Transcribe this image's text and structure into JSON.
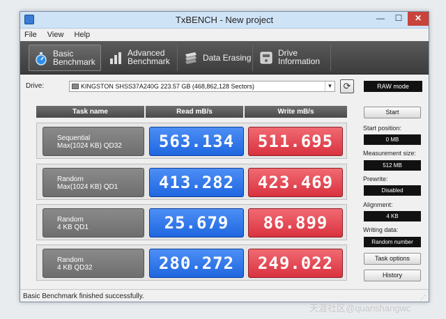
{
  "window": {
    "title": "TxBENCH - New project",
    "minimize_glyph": "—",
    "maximize_glyph": "☐",
    "close_glyph": "✕"
  },
  "menu": [
    "File",
    "View",
    "Help"
  ],
  "tabs": [
    {
      "label": "Basic\nBenchmark",
      "icon": "stopwatch-icon",
      "active": true
    },
    {
      "label": "Advanced\nBenchmark",
      "icon": "bar-chart-icon",
      "active": false
    },
    {
      "label": "Data Erasing",
      "icon": "eraser-icon",
      "active": false
    },
    {
      "label": "Drive\nInformation",
      "icon": "drive-info-icon",
      "active": false
    }
  ],
  "drive": {
    "label": "Drive:",
    "selected": "KINGSTON SHSS37A240G  223.57 GB (468,862,128 Sectors)",
    "raw_mode": "RAW mode"
  },
  "table": {
    "headers": [
      "Task name",
      "Read mB/s",
      "Write mB/s"
    ],
    "rows": [
      {
        "task": "Sequential\nMax(1024 KB) QD32",
        "read": "563.134",
        "write": "511.695"
      },
      {
        "task": "Random\nMax(1024 KB) QD1",
        "read": "413.282",
        "write": "423.469"
      },
      {
        "task": "Random\n4 KB QD1",
        "read": "25.679",
        "write": "86.899"
      },
      {
        "task": "Random\n4 KB QD32",
        "read": "280.272",
        "write": "249.022"
      }
    ]
  },
  "side": {
    "start": "Start",
    "start_position_label": "Start position:",
    "start_position": "0 MB",
    "measurement_size_label": "Measurement size:",
    "measurement_size": "512 MB",
    "prewrite_label": "Prewrite:",
    "prewrite": "Disabled",
    "alignment_label": "Alignment:",
    "alignment": "4 KB",
    "writing_data_label": "Writing data:",
    "writing_data": "Random number",
    "task_options": "Task options",
    "history": "History"
  },
  "status": "Basic Benchmark finished successfully.",
  "watermark": "天涯社区@quanshangwc",
  "colors": {
    "read": "#2f78ea",
    "write": "#e34a55",
    "toolbar": "#4a4a4a"
  }
}
